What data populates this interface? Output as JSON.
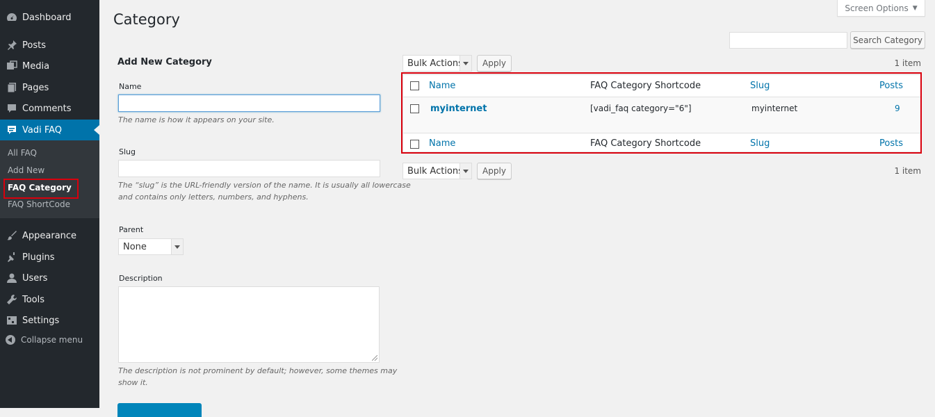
{
  "sidebar": {
    "items": [
      {
        "label": "Dashboard",
        "icon": "dashboard-icon"
      },
      {
        "label": "Posts",
        "icon": "pin-icon"
      },
      {
        "label": "Media",
        "icon": "media-icon"
      },
      {
        "label": "Pages",
        "icon": "pages-icon"
      },
      {
        "label": "Comments",
        "icon": "comment-icon"
      },
      {
        "label": "Vadi FAQ",
        "icon": "faq-icon"
      },
      {
        "label": "Appearance",
        "icon": "brush-icon"
      },
      {
        "label": "Plugins",
        "icon": "plugin-icon"
      },
      {
        "label": "Users",
        "icon": "user-icon"
      },
      {
        "label": "Tools",
        "icon": "wrench-icon"
      },
      {
        "label": "Settings",
        "icon": "settings-icon"
      }
    ],
    "submenu": [
      "All FAQ",
      "Add New",
      "FAQ Category",
      "FAQ ShortCode"
    ],
    "collapse": "Collapse menu"
  },
  "header": {
    "title": "Category",
    "screen_options": "Screen Options",
    "search_button": "Search Category"
  },
  "form": {
    "title": "Add New Category",
    "name_label": "Name",
    "name_help": "The name is how it appears on your site.",
    "slug_label": "Slug",
    "slug_help_1": "The “slug” is the URL-friendly version of the name. It is usually all lowercase",
    "slug_help_2": "and contains only letters, numbers, and hyphens.",
    "parent_label": "Parent",
    "parent_value": "None",
    "description_label": "Description",
    "description_help_1": "The description is not prominent by default; however, some themes may",
    "description_help_2": "show it."
  },
  "table": {
    "bulk_actions": "Bulk Actions",
    "apply": "Apply",
    "count": "1 item",
    "columns": [
      "Name",
      "FAQ Category Shortcode",
      "Slug",
      "Posts"
    ],
    "rows": [
      {
        "name": "myinternet",
        "shortcode": "[vadi_faq category=\"6\"]",
        "slug": "myinternet",
        "posts": "9"
      }
    ]
  },
  "colors": {
    "sidebar": "#23282d",
    "active": "#0073aa",
    "highlight": "#d9000d"
  }
}
